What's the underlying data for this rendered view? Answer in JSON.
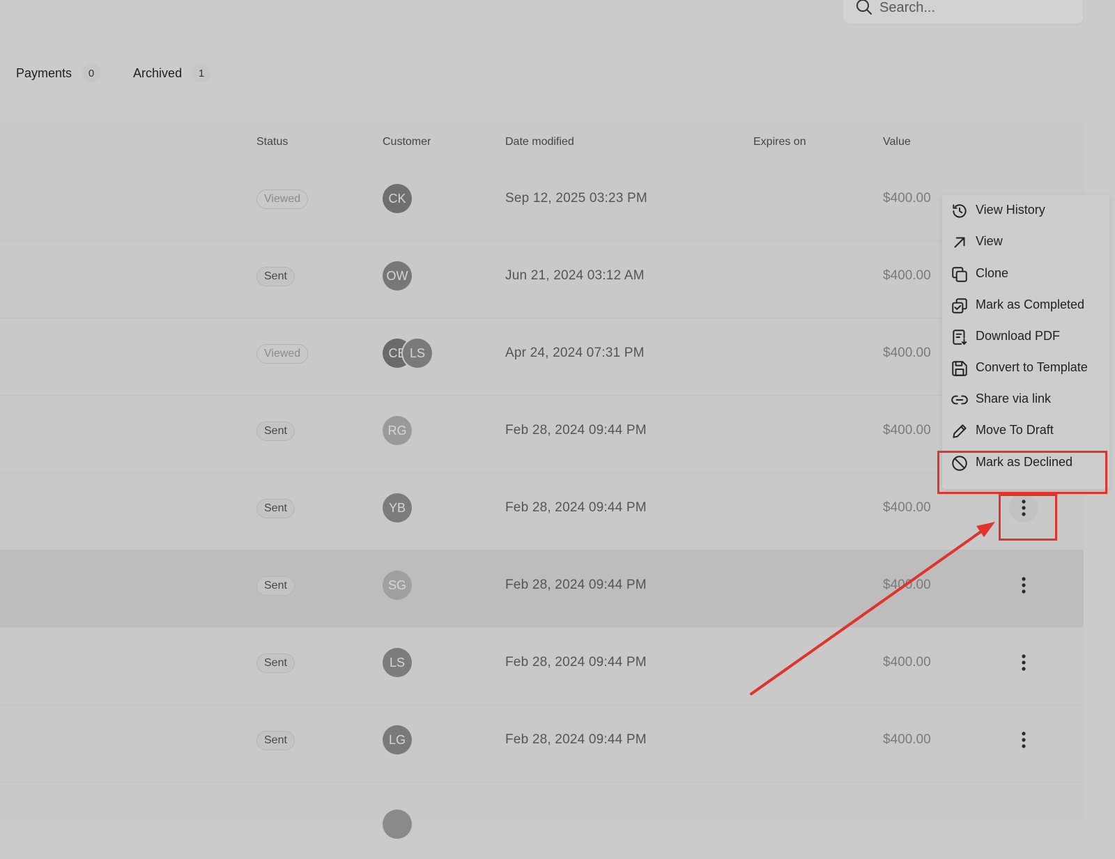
{
  "search": {
    "placeholder": "Search..."
  },
  "tabs": [
    {
      "label": "Payments",
      "count": "0"
    },
    {
      "label": "Archived",
      "count": "1"
    }
  ],
  "table": {
    "columns": [
      "Status",
      "Customer",
      "Date modified",
      "Expires on",
      "Value"
    ],
    "rows": [
      {
        "status": "Viewed",
        "avatars": [
          "CK"
        ],
        "date": "Sep 12, 2025 03:23 PM",
        "value": "$400.00"
      },
      {
        "status": "Sent",
        "avatars": [
          "OW"
        ],
        "date": "Jun 21, 2024 03:12 AM",
        "value": "$400.00"
      },
      {
        "status": "Viewed",
        "avatars": [
          "CE",
          "LS"
        ],
        "date": "Apr 24, 2024 07:31 PM",
        "value": "$400.00"
      },
      {
        "status": "Sent",
        "avatars": [
          "RG"
        ],
        "date": "Feb 28, 2024 09:44 PM",
        "value": "$400.00"
      },
      {
        "status": "Sent",
        "avatars": [
          "YB"
        ],
        "date": "Feb 28, 2024 09:44 PM",
        "value": "$400.00"
      },
      {
        "status": "Sent",
        "avatars": [
          "SG"
        ],
        "date": "Feb 28, 2024 09:44 PM",
        "value": "$400.00"
      },
      {
        "status": "Sent",
        "avatars": [
          "LS"
        ],
        "date": "Feb 28, 2024 09:44 PM",
        "value": "$400.00"
      },
      {
        "status": "Sent",
        "avatars": [
          "LG"
        ],
        "date": "Feb 28, 2024 09:44 PM",
        "value": "$400.00"
      }
    ]
  },
  "menu": {
    "items": [
      {
        "label": "View History",
        "icon": "clock-history-icon"
      },
      {
        "label": "View",
        "icon": "arrow-up-right-icon"
      },
      {
        "label": "Clone",
        "icon": "copy-icon"
      },
      {
        "label": "Mark as Completed",
        "icon": "copy-check-icon"
      },
      {
        "label": "Download PDF",
        "icon": "file-download-icon"
      },
      {
        "label": "Convert to Template",
        "icon": "save-icon"
      },
      {
        "label": "Share via link",
        "icon": "link-icon"
      },
      {
        "label": "Move To Draft",
        "icon": "pencil-icon"
      },
      {
        "label": "Mark as Declined",
        "icon": "ban-icon"
      }
    ]
  },
  "colors": {
    "annotation": "#e2332b",
    "avatar_CK": "#6f6f6f",
    "avatar_OW": "#777777",
    "avatar_CE": "#6a6a6a",
    "avatar_LS": "#7a7a7a",
    "avatar_RG": "#9a9a9a",
    "avatar_YB": "#7c7c7c",
    "avatar_SG": "#a0a0a0",
    "avatar_LS2": "#7c7c7c",
    "avatar_LG": "#7a7a7a"
  }
}
